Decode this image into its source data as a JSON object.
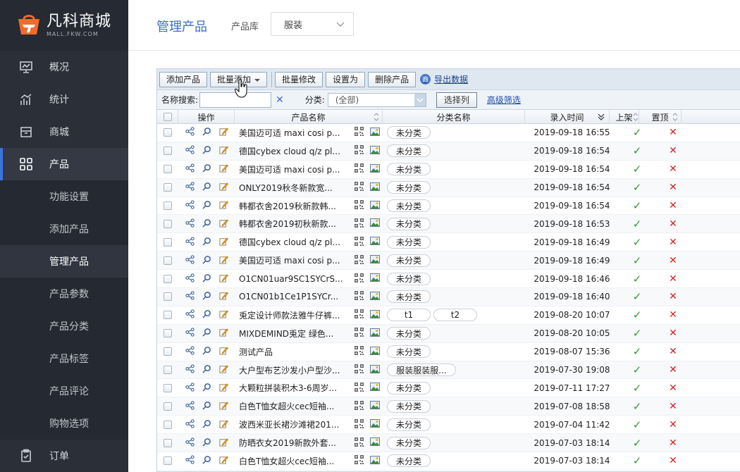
{
  "brand": {
    "name": "凡科商城",
    "sub": "MALL.FKW.COM"
  },
  "nav": {
    "overview": "概况",
    "stats": "统计",
    "mall": "商城",
    "product": "产品",
    "order": "订单",
    "sub_items": [
      "功能设置",
      "添加产品",
      "管理产品",
      "产品参数",
      "产品分类",
      "产品标签",
      "产品评论",
      "购物选项"
    ]
  },
  "header": {
    "title": "管理产品",
    "lib_label": "产品库",
    "lib_value": "服装"
  },
  "toolbar": {
    "add": "添加产品",
    "batch_add": "批量添加",
    "batch_edit": "批量修改",
    "set_as": "设置为",
    "delete": "删除产品",
    "export": "导出数据"
  },
  "filter": {
    "name_label": "名称搜索:",
    "category_label": "分类:",
    "category_value": "(全部)",
    "select_cols": "选择列",
    "advanced": "高级筛选"
  },
  "columns": {
    "op": "操作",
    "name": "产品名称",
    "category": "分类名称",
    "date": "录入时间",
    "on": "上架",
    "top": "置顶"
  },
  "rows": [
    {
      "name": "美国迈可适 maxi cosi p...",
      "tags": [
        "未分类"
      ],
      "date": "2019-09-18 16:55"
    },
    {
      "name": "德国cybex cloud q/z pl...",
      "tags": [
        "未分类"
      ],
      "date": "2019-09-18 16:54"
    },
    {
      "name": "美国迈可适 maxi cosi p...",
      "tags": [
        "未分类"
      ],
      "date": "2019-09-18 16:54"
    },
    {
      "name": "ONLY2019秋冬新款宽...",
      "tags": [
        "未分类"
      ],
      "date": "2019-09-18 16:54"
    },
    {
      "name": "韩都衣舍2019秋新款韩...",
      "tags": [
        "未分类"
      ],
      "date": "2019-09-18 16:54"
    },
    {
      "name": "韩都衣舍2019初秋新款...",
      "tags": [
        "未分类"
      ],
      "date": "2019-09-18 16:53"
    },
    {
      "name": "德国cybex cloud q/z pl...",
      "tags": [
        "未分类"
      ],
      "date": "2019-09-18 16:49"
    },
    {
      "name": "美国迈可适 maxi cosi p...",
      "tags": [
        "未分类"
      ],
      "date": "2019-09-18 16:49"
    },
    {
      "name": "O1CN01uar9SC1SYCrS...",
      "tags": [
        "未分类"
      ],
      "date": "2019-09-18 16:46"
    },
    {
      "name": "O1CN01b1Ce1P1SYCr...",
      "tags": [
        "未分类"
      ],
      "date": "2019-09-18 16:40"
    },
    {
      "name": "兎定设计师款法雅牛仔裤...",
      "tags": [
        "t1",
        "t2"
      ],
      "date": "2019-08-20 10:07"
    },
    {
      "name": "MIXDEMIND兎定 绿色...",
      "tags": [
        "未分类"
      ],
      "date": "2019-08-20 10:05"
    },
    {
      "name": "测试产品",
      "tags": [
        "未分类"
      ],
      "date": "2019-08-07 15:36"
    },
    {
      "name": "大户型布艺沙发小户型沙...",
      "tags": [
        "服装服装服..."
      ],
      "date": "2019-07-30 19:08"
    },
    {
      "name": "大颗粒拼装积木3-6周岁...",
      "tags": [
        "未分类"
      ],
      "date": "2019-07-11 17:27"
    },
    {
      "name": "白色T恤女超火cec短袖...",
      "tags": [
        "未分类"
      ],
      "date": "2019-07-08 18:58"
    },
    {
      "name": "波西米亚长裙沙滩裙201...",
      "tags": [
        "未分类"
      ],
      "date": "2019-07-04 11:42"
    },
    {
      "name": "防晒衣女2019新款外套...",
      "tags": [
        "未分类"
      ],
      "date": "2019-07-03 18:14"
    },
    {
      "name": "白色T恤女超火cec短袖...",
      "tags": [
        "未分类"
      ],
      "date": "2019-07-03 18:14"
    }
  ],
  "colors": {
    "accent": "#3d72e0",
    "sidebar": "#2b2f38",
    "check": "#2e9a2e",
    "cross": "#d32424"
  }
}
